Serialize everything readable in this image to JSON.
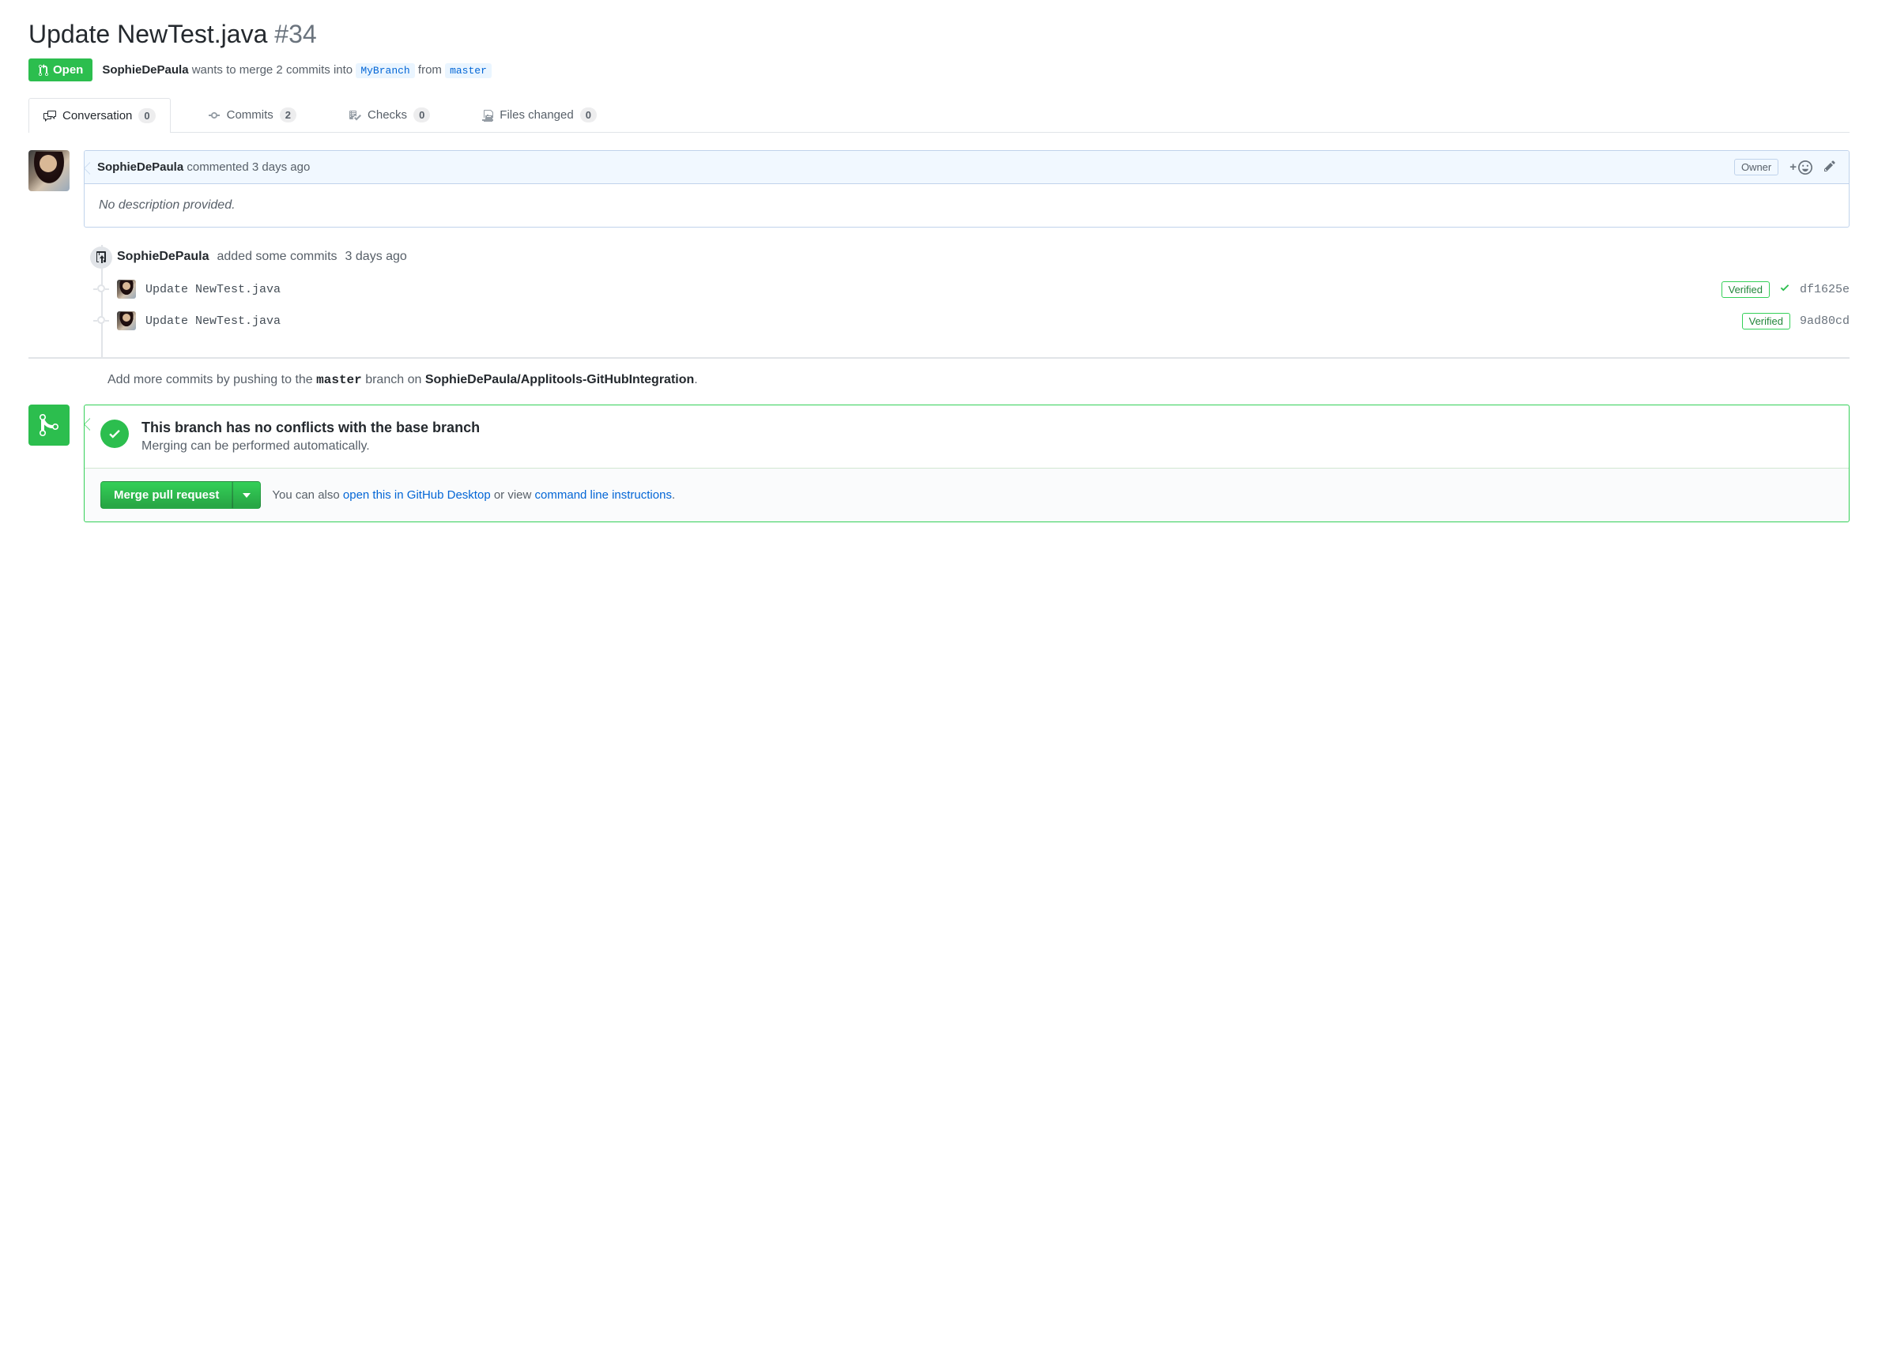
{
  "title": "Update NewTest.java",
  "number": "#34",
  "state": "Open",
  "author": "SophieDePaula",
  "merge_text_1": "wants to merge 2 commits into",
  "base_branch": "MyBranch",
  "merge_text_2": "from",
  "head_branch": "master",
  "tabs": {
    "conversation": {
      "label": "Conversation",
      "count": "0"
    },
    "commits": {
      "label": "Commits",
      "count": "2"
    },
    "checks": {
      "label": "Checks",
      "count": "0"
    },
    "files": {
      "label": "Files changed",
      "count": "0"
    }
  },
  "comment": {
    "author": "SophieDePaula",
    "action": "commented",
    "time": "3 days ago",
    "owner_label": "Owner",
    "body": "No description provided."
  },
  "commits_event": {
    "author": "SophieDePaula",
    "text": "added some commits",
    "time": "3 days ago"
  },
  "commits": [
    {
      "msg": "Update NewTest.java",
      "verified": "Verified",
      "sha": "df1625e",
      "has_check": true
    },
    {
      "msg": "Update NewTest.java",
      "verified": "Verified",
      "sha": "9ad80cd",
      "has_check": false
    }
  ],
  "push_hint": {
    "prefix": "Add more commits by pushing to the",
    "branch": "master",
    "mid": "branch on",
    "repo": "SophieDePaula/Applitools-GitHubIntegration",
    "suffix": "."
  },
  "merge_status": {
    "title": "This branch has no conflicts with the base branch",
    "desc": "Merging can be performed automatically."
  },
  "merge_actions": {
    "button": "Merge pull request",
    "note_prefix": "You can also",
    "link1": "open this in GitHub Desktop",
    "note_mid": "or view",
    "link2": "command line instructions",
    "note_suffix": "."
  }
}
